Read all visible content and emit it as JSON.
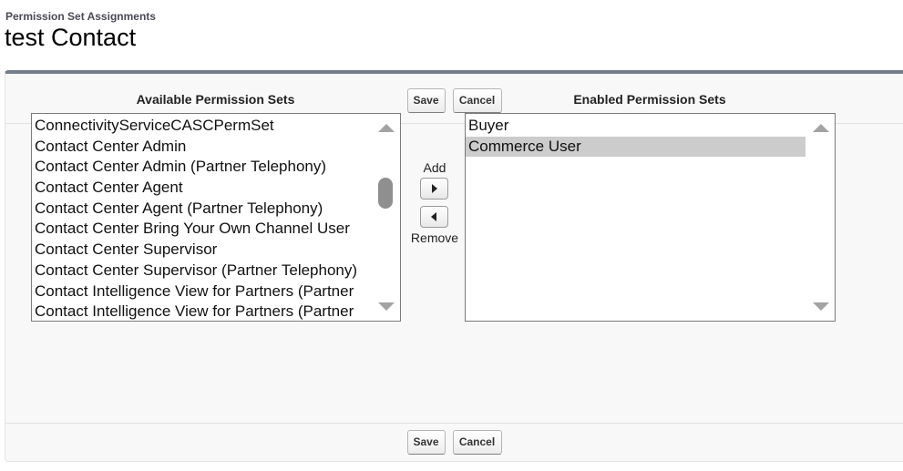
{
  "header": {
    "subtitle": "Permission Set Assignments",
    "title": "test Contact"
  },
  "buttons": {
    "save": "Save",
    "cancel": "Cancel"
  },
  "available": {
    "label": "Available Permission Sets",
    "items": [
      "ConnectivityServiceCASCPermSet",
      "Contact Center Admin",
      "Contact Center Admin (Partner Telephony)",
      "Contact Center Agent",
      "Contact Center Agent (Partner Telephony)",
      "Contact Center Bring Your Own Channel User",
      "Contact Center Supervisor",
      "Contact Center Supervisor (Partner Telephony)",
      "Contact Intelligence View for Partners (Partner",
      "Contact Intelligence View for Partners (Partner"
    ]
  },
  "enabled": {
    "label": "Enabled Permission Sets",
    "items": [
      "Buyer",
      "Commerce User"
    ],
    "selected_item": "Commerce User"
  },
  "mover": {
    "add_label": "Add",
    "remove_label": "Remove"
  },
  "icons": {
    "add": "triangle-right-icon",
    "remove": "triangle-left-icon",
    "scroll_up": "scroll-up-icon",
    "scroll_down": "scroll-down-icon"
  }
}
